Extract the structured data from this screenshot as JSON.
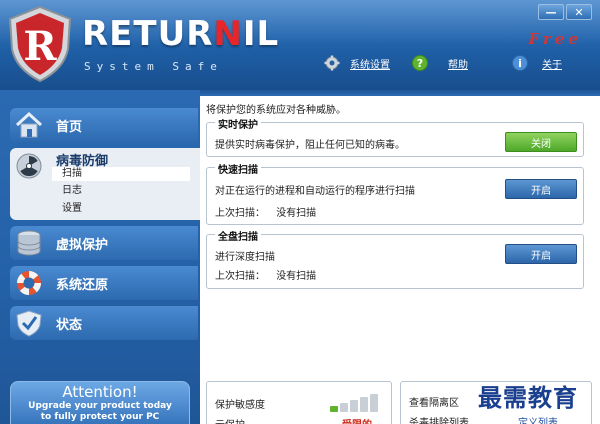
{
  "header": {
    "brand_pre": "RETUR",
    "brand_accent": "N",
    "brand_post": "IL",
    "tagline": "System Safe",
    "edition": "Free",
    "minimize_label": "—",
    "close_label": "✕",
    "nav": [
      {
        "label": "系统设置",
        "icon": "gear-icon"
      },
      {
        "label": "帮助",
        "icon": "help-icon"
      },
      {
        "label": "关于",
        "icon": "info-icon"
      }
    ]
  },
  "sidebar": {
    "items": [
      {
        "label": "首页",
        "icon": "home-icon"
      },
      {
        "label": "病毒防御",
        "icon": "radiation-icon",
        "sub": [
          "扫描",
          "日志",
          "设置"
        ]
      },
      {
        "label": "虚拟保护",
        "icon": "database-icon"
      },
      {
        "label": "系统还原",
        "icon": "lifebuoy-icon"
      },
      {
        "label": "状态",
        "icon": "check-icon"
      }
    ],
    "attention": {
      "title": "Attention!",
      "line1": "Upgrade your product today",
      "line2": "to fully protect your PC"
    }
  },
  "main": {
    "intro": "将保护您的系统应对各种威胁。",
    "realtime": {
      "title": "实时保护",
      "desc": "提供实时病毒保护，阻止任何已知的病毒。",
      "button": "关闭"
    },
    "quick_scan": {
      "title": "快速扫描",
      "desc": "对正在运行的进程和自动运行的程序进行扫描",
      "last_scan_label": "上次扫描：",
      "last_scan_value": "没有扫描",
      "button": "开启"
    },
    "full_scan": {
      "title": "全盘扫描",
      "desc": "进行深度扫描",
      "last_scan_label": "上次扫描：",
      "last_scan_value": "没有扫描",
      "button": "开启"
    },
    "bottom_left": {
      "sensitivity_label": "保护敏感度",
      "row2_label": "云保护",
      "level_text": "受限的",
      "level_fraction": 0.2
    },
    "bottom_right": {
      "quarantine_label": "查看隔离区",
      "exclusion_label": "杀毒排除列表",
      "custom_link": "定义列表"
    },
    "watermark": "最需教育"
  },
  "colors": {
    "header": "#1f5fa6",
    "sidebar": "#2460a6",
    "accent_red": "#e8262a",
    "green_button": "#4fa82a",
    "blue_button": "#2d66a9"
  }
}
